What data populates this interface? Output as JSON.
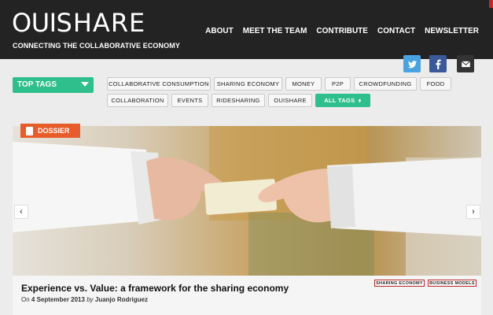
{
  "header": {
    "logo_light": "OUI",
    "logo_bold": "SHARE",
    "tagline": "CONNECTING THE COLLABORATIVE ECONOMY",
    "nav": [
      "ABOUT",
      "MEET THE TEAM",
      "CONTRIBUTE",
      "CONTACT",
      "NEWSLETTER"
    ]
  },
  "social": [
    "twitter-icon",
    "facebook-icon",
    "email-icon"
  ],
  "top_tags": {
    "label": "TOP TAGS"
  },
  "tags": {
    "row1": [
      "COLLABORATIVE CONSUMPTION",
      "SHARING ECONOMY",
      "MONEY",
      "P2P",
      "CROWDFUNDING",
      "FOOD"
    ],
    "row2": [
      "COLLABORATION",
      "EVENTS",
      "RIDESHARING",
      "OUISHARE"
    ],
    "all_tags": "ALL TAGS"
  },
  "feature": {
    "badge": "DOSSIER",
    "title": "Experience vs. Value: a framework for the sharing economy",
    "meta_on": "On",
    "date": "4 September 2013",
    "meta_by": "by",
    "author": "Juanjo Rodriguez",
    "tags": [
      "SHARING ECONOMY",
      "BUSINESS MODELS"
    ]
  },
  "colors": {
    "accent": "#2fbf8c",
    "badge": "#e85b2a",
    "header": "#232323"
  }
}
